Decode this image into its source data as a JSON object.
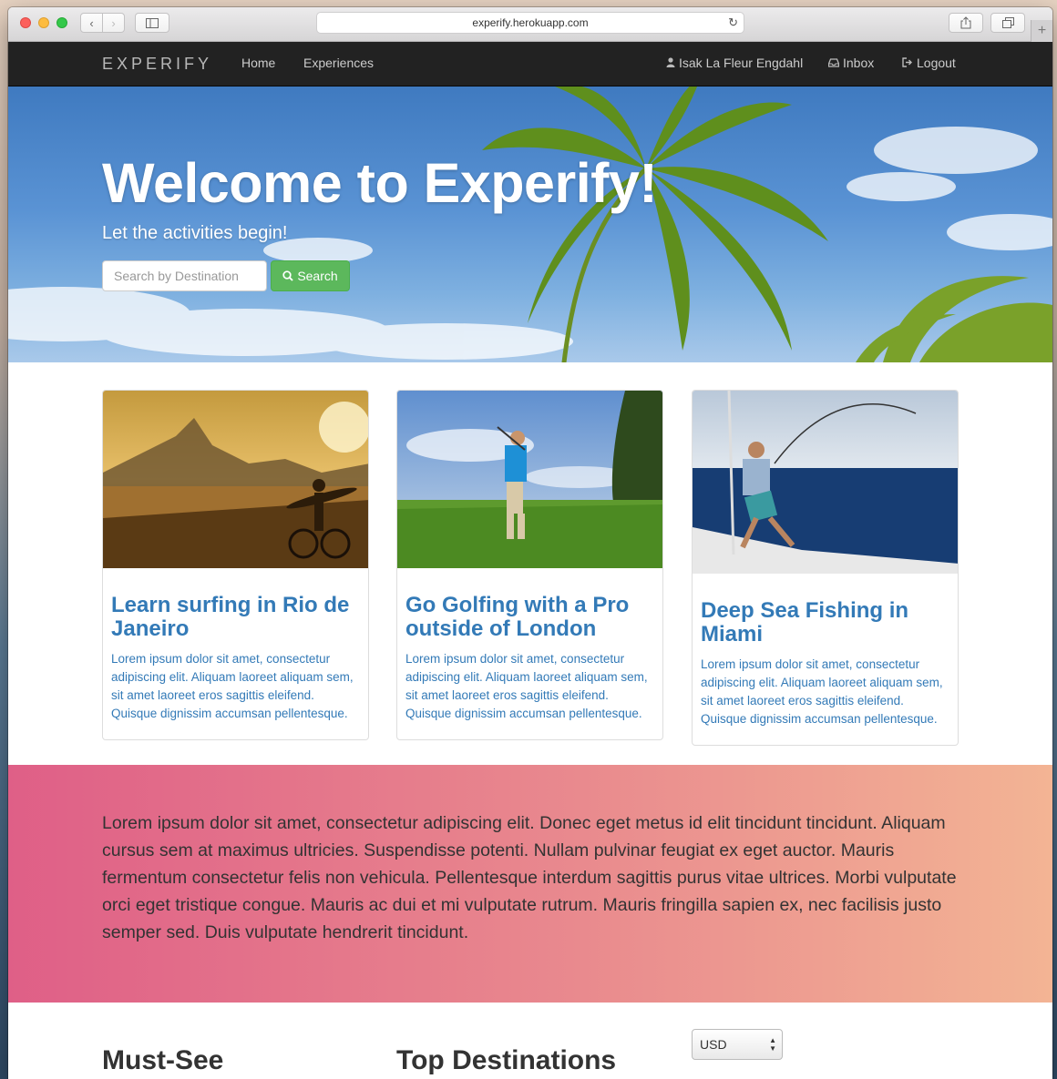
{
  "browser": {
    "url": "experify.herokuapp.com",
    "back_icon": "‹",
    "forward_icon": "›",
    "reload_icon": "↻",
    "newtab_icon": "+"
  },
  "navbar": {
    "brand": "EXPERIFY",
    "links": [
      {
        "label": "Home"
      },
      {
        "label": "Experiences"
      }
    ],
    "user_label": "Isak La Fleur Engdahl",
    "inbox_label": "Inbox",
    "logout_label": "Logout"
  },
  "hero": {
    "title": "Welcome to Experify!",
    "subtitle": "Let the activities begin!",
    "search_placeholder": "Search by Destination",
    "search_button": "Search"
  },
  "cards": [
    {
      "title": "Learn surfing in Rio de Janeiro",
      "body": "Lorem ipsum dolor sit amet, consectetur adipiscing elit. Aliquam laoreet aliquam sem, sit amet laoreet eros sagittis eleifend. Quisque dignissim accumsan pellentesque."
    },
    {
      "title": "Go Golfing with a Pro outside of London",
      "body": "Lorem ipsum dolor sit amet, consectetur adipiscing elit. Aliquam laoreet aliquam sem, sit amet laoreet eros sagittis eleifend. Quisque dignissim accumsan pellentesque."
    },
    {
      "title": "Deep Sea Fishing in Miami",
      "body": "Lorem ipsum dolor sit amet, consectetur adipiscing elit. Aliquam laoreet aliquam sem, sit amet laoreet eros sagittis eleifend. Quisque dignissim accumsan pellentesque."
    }
  ],
  "band": {
    "text": "Lorem ipsum dolor sit amet, consectetur adipiscing elit. Donec eget metus id elit tincidunt tincidunt. Aliquam cursus sem at maximus ultricies. Suspendisse potenti. Nullam pulvinar feugiat ex eget auctor. Mauris fermentum consectetur felis non vehicula. Pellentesque interdum sagittis purus vitae ultrices. Morbi vulputate orci eget tristique congue. Mauris ac dui et mi vulputate rutrum. Mauris fringilla sapien ex, nec facilisis justo semper sed. Duis vulputate hendrerit tincidunt."
  },
  "bottom": {
    "must_see": "Must-See",
    "top_destinations": "Top Destinations",
    "currency": "USD"
  },
  "colors": {
    "navbar": "#222222",
    "link_blue": "#337ab7",
    "search_green": "#5cb85c",
    "band_start": "#df5f87",
    "band_end": "#f3b494"
  }
}
